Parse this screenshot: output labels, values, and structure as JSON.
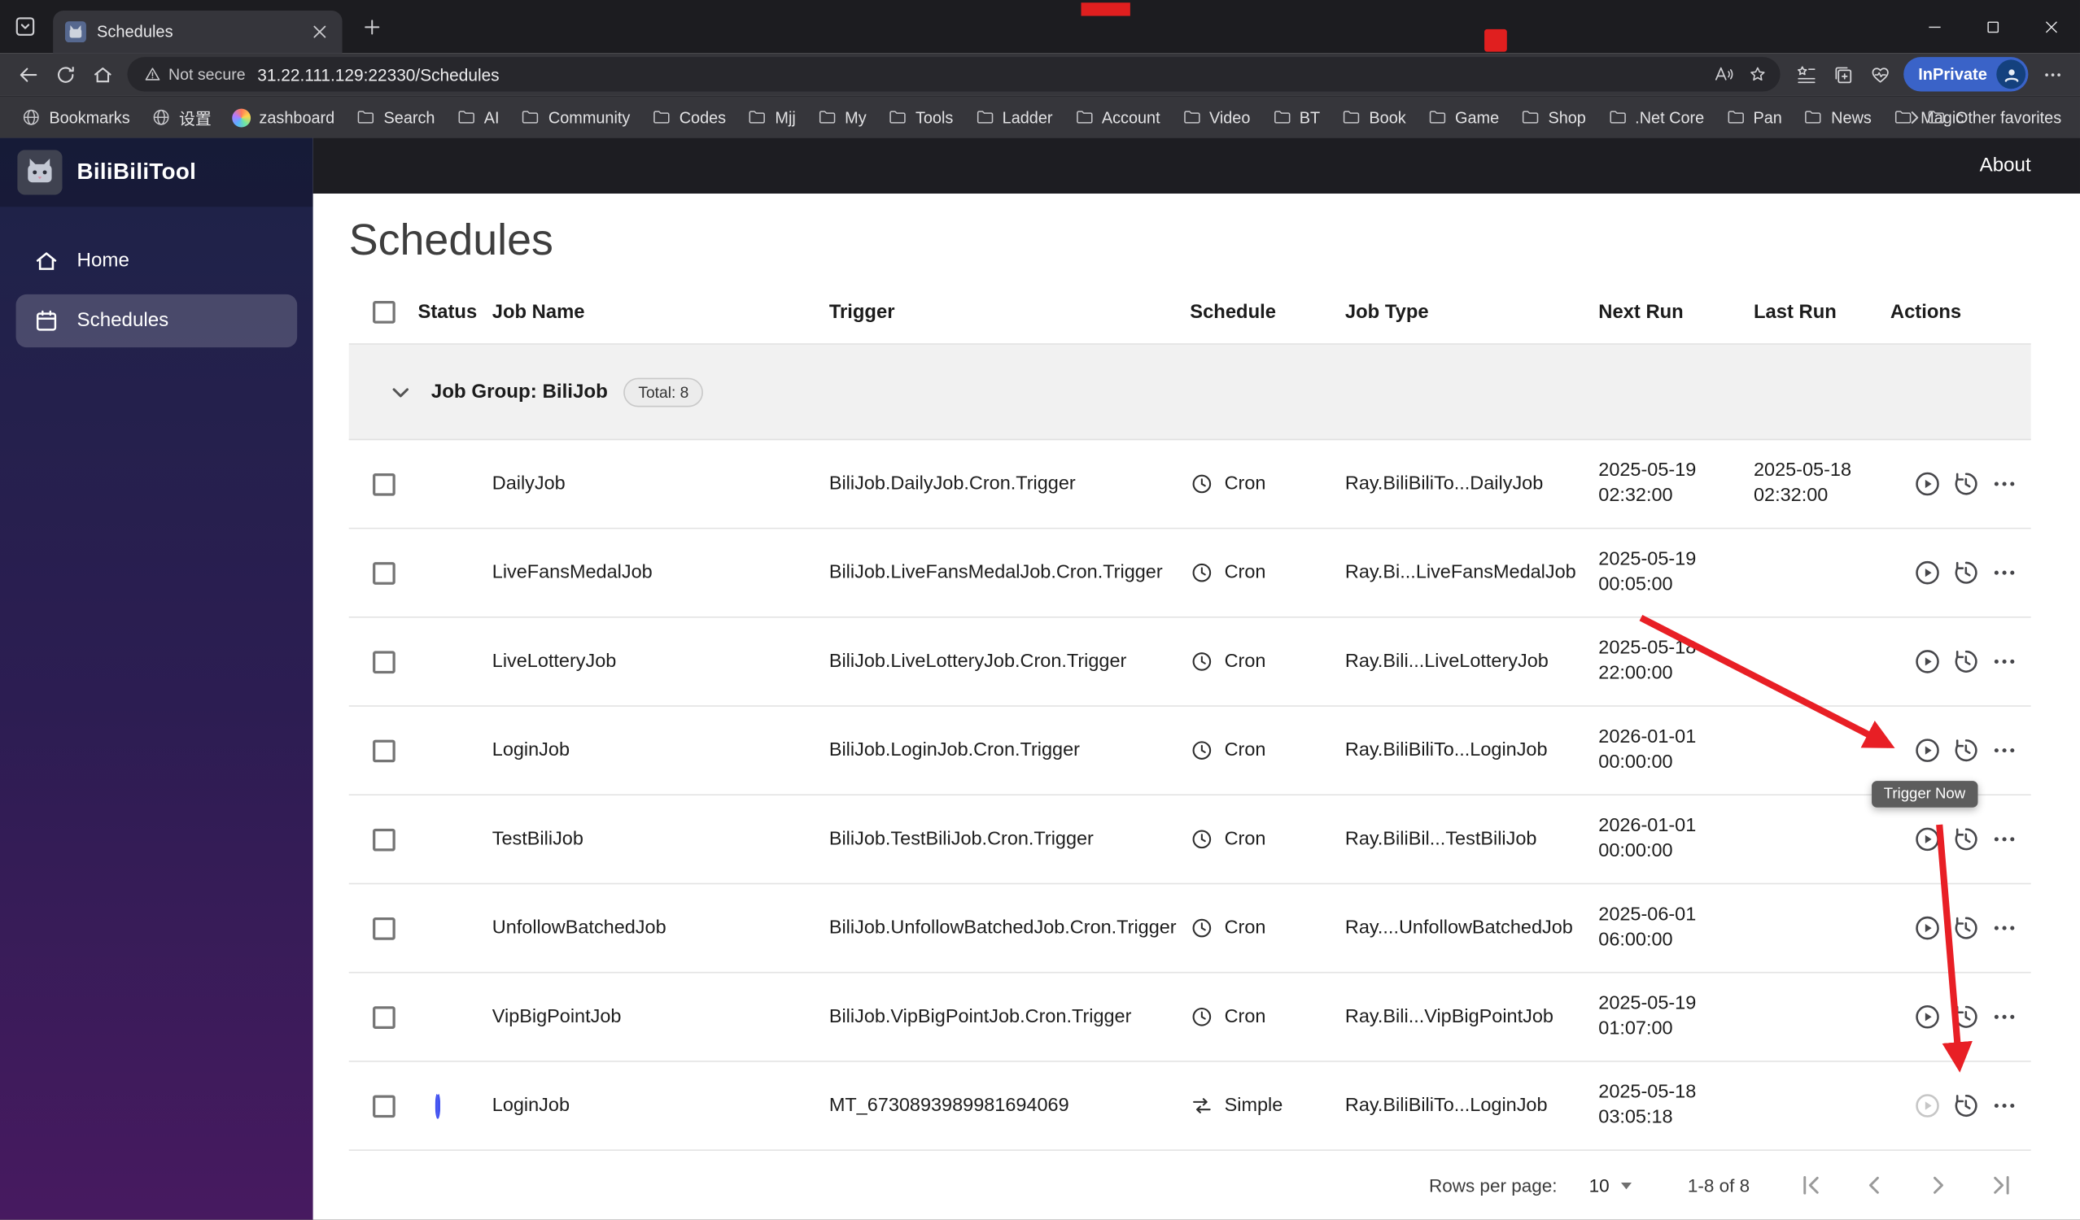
{
  "browser": {
    "tab_title": "Schedules",
    "security_label": "Not secure",
    "url": "31.22.111.129:22330/Schedules",
    "inprivate_label": "InPrivate",
    "other_favorites_label": "Other favorites",
    "bookmarks": [
      {
        "label": "Bookmarks",
        "icon": "globe"
      },
      {
        "label": "设置",
        "icon": "globe"
      },
      {
        "label": "zashboard",
        "icon": "app"
      },
      {
        "label": "Search",
        "icon": "folder"
      },
      {
        "label": "AI",
        "icon": "folder"
      },
      {
        "label": "Community",
        "icon": "folder"
      },
      {
        "label": "Codes",
        "icon": "folder"
      },
      {
        "label": "Mjj",
        "icon": "folder"
      },
      {
        "label": "My",
        "icon": "folder"
      },
      {
        "label": "Tools",
        "icon": "folder"
      },
      {
        "label": "Ladder",
        "icon": "folder"
      },
      {
        "label": "Account",
        "icon": "folder"
      },
      {
        "label": "Video",
        "icon": "folder"
      },
      {
        "label": "BT",
        "icon": "folder"
      },
      {
        "label": "Book",
        "icon": "folder"
      },
      {
        "label": "Game",
        "icon": "folder"
      },
      {
        "label": "Shop",
        "icon": "folder"
      },
      {
        "label": ".Net Core",
        "icon": "folder"
      },
      {
        "label": "Pan",
        "icon": "folder"
      },
      {
        "label": "News",
        "icon": "folder"
      },
      {
        "label": "Magic",
        "icon": "folder"
      }
    ]
  },
  "app": {
    "brand": "BiliBiliTool",
    "about_label": "About",
    "page_title": "Schedules",
    "tooltip": "Trigger Now",
    "nav": [
      {
        "label": "Home"
      },
      {
        "label": "Schedules"
      }
    ],
    "table": {
      "columns": [
        "Status",
        "Job Name",
        "Trigger",
        "Schedule",
        "Job Type",
        "Next Run",
        "Last Run",
        "Actions"
      ],
      "group": {
        "label": "Job Group: BiliJob",
        "total_chip": "Total: 8"
      },
      "rows": [
        {
          "status": "green",
          "job": "DailyJob",
          "trigger": "BiliJob.DailyJob.Cron.Trigger",
          "schedule": "Cron",
          "schedule_kind": "cron",
          "job_type": "Ray.BiliBiliTo...DailyJob",
          "next_run": "2025-05-19 02:32:00",
          "last_run": "2025-05-18 02:32:00",
          "play": "enabled"
        },
        {
          "status": "green",
          "job": "LiveFansMedalJob",
          "trigger": "BiliJob.LiveFansMedalJob.Cron.Trigger",
          "schedule": "Cron",
          "schedule_kind": "cron",
          "job_type": "Ray.Bi...LiveFansMedalJob",
          "next_run": "2025-05-19 00:05:00",
          "last_run": "",
          "play": "enabled"
        },
        {
          "status": "green",
          "job": "LiveLotteryJob",
          "trigger": "BiliJob.LiveLotteryJob.Cron.Trigger",
          "schedule": "Cron",
          "schedule_kind": "cron",
          "job_type": "Ray.Bili...LiveLotteryJob",
          "next_run": "2025-05-18 22:00:00",
          "last_run": "",
          "play": "enabled"
        },
        {
          "status": "green",
          "job": "LoginJob",
          "trigger": "BiliJob.LoginJob.Cron.Trigger",
          "schedule": "Cron",
          "schedule_kind": "cron",
          "job_type": "Ray.BiliBiliTo...LoginJob",
          "next_run": "2026-01-01 00:00:00",
          "last_run": "",
          "play": "enabled"
        },
        {
          "status": "green",
          "job": "TestBiliJob",
          "trigger": "BiliJob.TestBiliJob.Cron.Trigger",
          "schedule": "Cron",
          "schedule_kind": "cron",
          "job_type": "Ray.BiliBil...TestBiliJob",
          "next_run": "2026-01-01 00:00:00",
          "last_run": "",
          "play": "enabled"
        },
        {
          "status": "green",
          "job": "UnfollowBatchedJob",
          "trigger": "BiliJob.UnfollowBatchedJob.Cron.Trigger",
          "schedule": "Cron",
          "schedule_kind": "cron",
          "job_type": "Ray....UnfollowBatchedJob",
          "next_run": "2025-06-01 06:00:00",
          "last_run": "",
          "play": "enabled"
        },
        {
          "status": "green",
          "job": "VipBigPointJob",
          "trigger": "BiliJob.VipBigPointJob.Cron.Trigger",
          "schedule": "Cron",
          "schedule_kind": "cron",
          "job_type": "Ray.Bili...VipBigPointJob",
          "next_run": "2025-05-19 01:07:00",
          "last_run": "",
          "play": "enabled"
        },
        {
          "status": "ring",
          "job": "LoginJob",
          "trigger": "MT_6730893989981694069",
          "schedule": "Simple",
          "schedule_kind": "simple",
          "job_type": "Ray.BiliBiliTo...LoginJob",
          "next_run": "2025-05-18 03:05:18",
          "last_run": "",
          "play": "disabled"
        }
      ],
      "footer": {
        "rows_per_page_label": "Rows per page:",
        "rows_per_page_value": "10",
        "range_label": "1-8 of 8"
      }
    }
  },
  "colors": {
    "chrome_bg": "#1c1c20",
    "toolbar_bg": "#36363b",
    "urlbar_bg": "#27272c",
    "inprivate_blue": "#3a63c8",
    "marker_red": "#e01f1f",
    "sidebar_top": "#1d2347",
    "sidebar_mid": "#2c1d52",
    "sidebar_bottom": "#471a60",
    "selected_nav": "rgba(255,255,255,0.18)",
    "appbar": "#1d1d22",
    "status_green": "#4caf50",
    "spinner_blue": "#4353f0",
    "annotation_red": "#e81f25",
    "tooltip_bg": "#5d5d5d"
  }
}
